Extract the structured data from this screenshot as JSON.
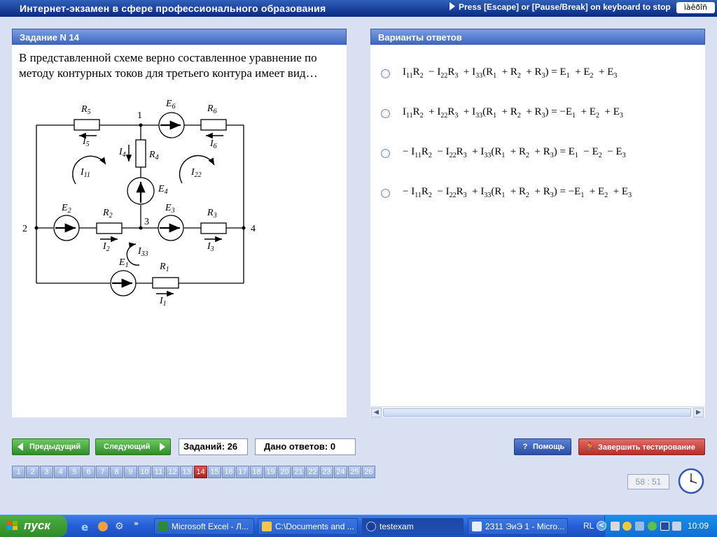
{
  "topbar": {
    "title": "Интернет-экзамен в сфере профессионального образования",
    "hint": "Press [Escape] or [Pause/Break] on keyboard to stop",
    "keyboard_indicator": "ìàêðîñ"
  },
  "question": {
    "header": "Задание N 14",
    "text": "В представленной схеме верно составленное уравнение по методу контурных токов для третьего контура имеет вид…"
  },
  "circuit": {
    "nodes": [
      "1",
      "2",
      "3",
      "4"
    ],
    "resistors": [
      "R5",
      "R6",
      "R4",
      "R2",
      "R3",
      "R1"
    ],
    "sources": [
      "E6",
      "E4",
      "E2",
      "E3",
      "E1"
    ],
    "branch_currents": [
      "I5",
      "I6",
      "I4",
      "I2",
      "I3",
      "I1"
    ],
    "loop_currents": [
      "I11",
      "I22",
      "I33"
    ]
  },
  "answers": {
    "header": "Варианты ответов",
    "options": [
      {
        "label": "option-1"
      },
      {
        "label": "option-2"
      },
      {
        "label": "option-3"
      },
      {
        "label": "option-4"
      }
    ]
  },
  "nav": {
    "prev_label": "Предыдущий",
    "next_label": "Следующий",
    "tasks_count": "Заданий: 26",
    "answers_given": "Дано ответов: 0",
    "help_label": "Помощь",
    "finish_label": "Завершить тестирование",
    "question_numbers": [
      "1",
      "2",
      "3",
      "4",
      "5",
      "6",
      "7",
      "8",
      "9",
      "10",
      "11",
      "12",
      "13",
      "14",
      "15",
      "16",
      "17",
      "18",
      "19",
      "20",
      "21",
      "22",
      "23",
      "24",
      "25",
      "26"
    ],
    "current_question": "14",
    "timer": "58 : 51"
  },
  "taskbar": {
    "start_label": "пуск",
    "tasks": [
      "Microsoft Excel - Л...",
      "C:\\Documents and ...",
      "testexam",
      "2311 ЭиЭ 1 - Micro..."
    ],
    "lang": "RL",
    "clock": "10:09"
  },
  "colors": {
    "title_bar": "#0a2a83",
    "panel_header": "#5a7fd3",
    "active_question": "#c2322b",
    "finish_button": "#c63a33",
    "green_button": "#3f9c36"
  }
}
